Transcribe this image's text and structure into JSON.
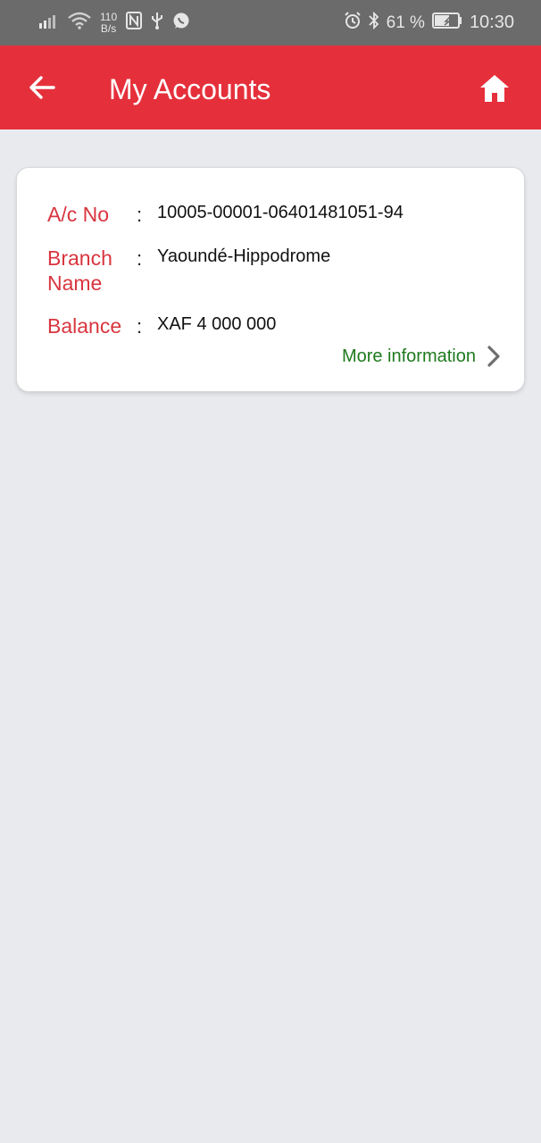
{
  "status_bar": {
    "net_speed_value": "110",
    "net_speed_unit": "B/s",
    "battery_text": "61 %",
    "time": "10:30",
    "icons": [
      "signal-icon",
      "wifi-icon",
      "nfc-icon",
      "usb-icon",
      "whatsapp-icon",
      "alarm-icon",
      "bluetooth-icon",
      "battery-icon"
    ]
  },
  "header": {
    "title": "My Accounts",
    "background_color": "#e5303b"
  },
  "account": {
    "fields": [
      {
        "label": "A/c No",
        "value": "10005-00001-06401481051-94"
      },
      {
        "label_line1": "Branch",
        "label_line2": "Name",
        "value": "Yaoundé-Hippodrome"
      },
      {
        "label": "Balance",
        "value": "XAF 4 000 000"
      }
    ],
    "separator": ":",
    "more_info_label": "More information"
  },
  "colors": {
    "label": "#d9353f",
    "link": "#1e7a1e"
  }
}
